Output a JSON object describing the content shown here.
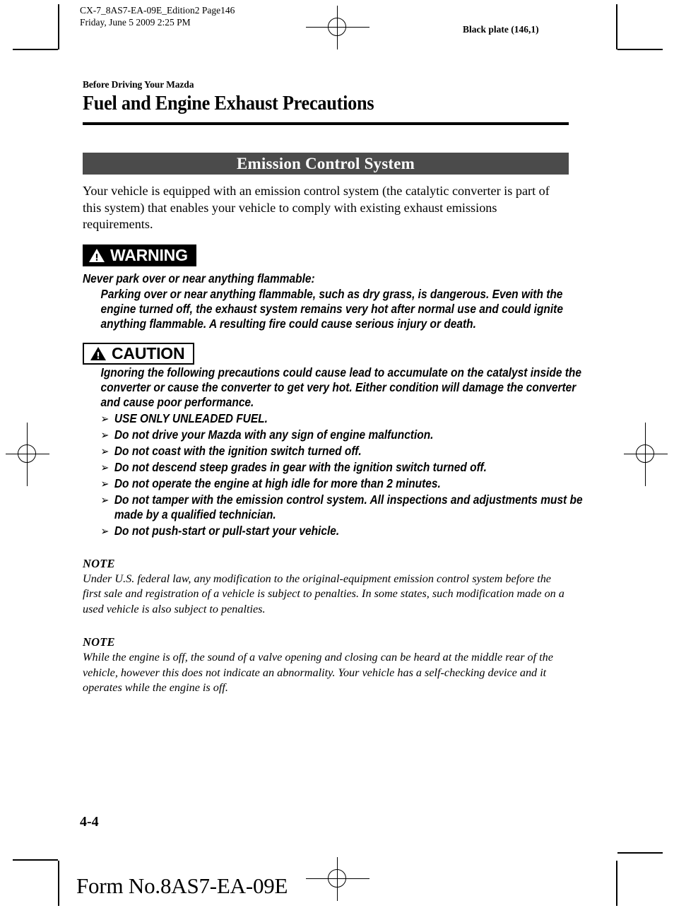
{
  "prepress": {
    "slug_line1": "CX-7_8AS7-EA-09E_Edition2 Page146",
    "slug_line2": "Friday, June 5 2009 2:25 PM",
    "plate_note": "Black plate (146,1)"
  },
  "header": {
    "chapter_label": "Before Driving Your Mazda",
    "page_title": "Fuel and Engine Exhaust Precautions"
  },
  "section": {
    "banner_title": "Emission Control System",
    "banner_bg": "#4b4b4b",
    "banner_fg": "#ffffff",
    "intro_paragraph": "Your vehicle is equipped with an emission control system (the catalytic converter is part of this system) that enables your vehicle to comply with existing exhaust emissions requirements."
  },
  "warning": {
    "label": "WARNING",
    "icon": "warning-triangle-icon",
    "heading": "Never park over or near anything flammable:",
    "body": "Parking over or near anything flammable, such as dry grass, is dangerous. Even with the engine turned off, the exhaust system remains very hot after normal use and could ignite anything flammable. A resulting fire could cause serious injury or death."
  },
  "caution": {
    "label": "CAUTION",
    "icon": "caution-triangle-icon",
    "body": "Ignoring the following precautions could cause lead to accumulate on the catalyst inside the converter or cause the converter to get very hot. Either condition will damage the converter and cause poor performance.",
    "bullet_glyph": "➢",
    "bullets": [
      "USE ONLY UNLEADED FUEL.",
      "Do not drive your Mazda with any sign of engine malfunction.",
      "Do not coast with the ignition switch turned off.",
      "Do not descend steep grades in gear with the ignition switch turned off.",
      "Do not operate the engine at high idle for more than 2 minutes.",
      "Do not tamper with the emission control system. All inspections and adjustments must be made by a qualified technician.",
      "Do not push-start or pull-start your vehicle."
    ]
  },
  "notes": [
    {
      "heading": "NOTE",
      "body": "Under U.S. federal law, any modification to the original-equipment emission control system before the first sale and registration of a vehicle is subject to penalties. In some states, such modification made on a used vehicle is also subject to penalties."
    },
    {
      "heading": "NOTE",
      "body": "While the engine is off, the sound of a valve opening and closing can be heard at the middle rear of the vehicle, however this does not indicate an abnormality. Your vehicle has a self-checking device and it operates while the engine is off."
    }
  ],
  "footer": {
    "folio": "4-4",
    "form_number": "Form No.8AS7-EA-09E"
  }
}
